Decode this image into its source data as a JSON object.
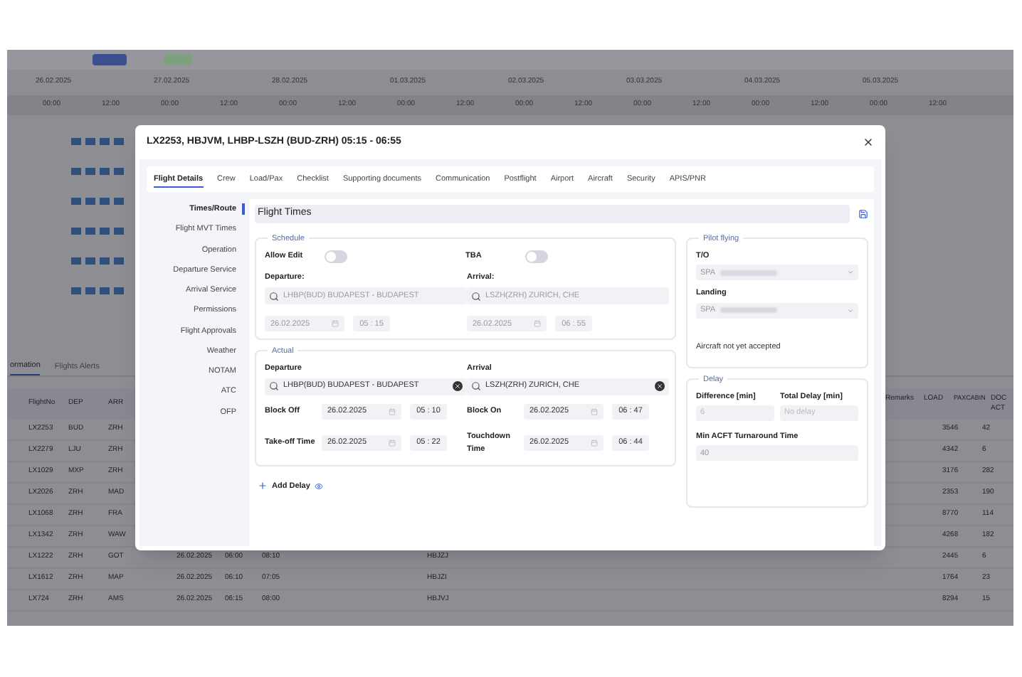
{
  "background": {
    "dates": [
      "26.02.2025",
      "27.02.2025",
      "28.02.2025",
      "01.03.2025",
      "02.03.2025",
      "03.03.2025",
      "04.03.2025",
      "05.03.2025"
    ],
    "times": [
      "00:00",
      "12:00",
      "00:00",
      "12:00",
      "00:00",
      "12:00",
      "00:00",
      "12:00",
      "00:00",
      "12:00",
      "00:00",
      "12:00",
      "00:00",
      "12:00",
      "00:00",
      "12:00"
    ],
    "bottom_tabs": [
      {
        "label": "ormation",
        "selected": true
      },
      {
        "label": "Flights Alerts",
        "selected": false
      }
    ],
    "left_columns": [
      "FlightNo",
      "DEP",
      "ARR"
    ],
    "right_columns": [
      "Remarks",
      "LOAD",
      "PAXCABIN",
      "DOC ACT"
    ],
    "rows": [
      {
        "flight_no": "LX2253",
        "dep": "BUD",
        "arr": "ZRH",
        "paxcabin": "3546",
        "doc_act": "42"
      },
      {
        "flight_no": "LX2279",
        "dep": "LJU",
        "arr": "ZRH",
        "paxcabin": "4342",
        "doc_act": "6"
      },
      {
        "flight_no": "LX1029",
        "dep": "MXP",
        "arr": "ZRH",
        "paxcabin": "3176",
        "doc_act": "282"
      },
      {
        "flight_no": "LX2026",
        "dep": "ZRH",
        "arr": "MAD",
        "paxcabin": "2353",
        "doc_act": "190"
      },
      {
        "flight_no": "LX1068",
        "dep": "ZRH",
        "arr": "FRA",
        "paxcabin": "8770",
        "doc_act": "114"
      },
      {
        "flight_no": "LX1342",
        "dep": "ZRH",
        "arr": "WAW",
        "paxcabin": "4268",
        "doc_act": "182"
      },
      {
        "flight_no": "LX1222",
        "dep": "ZRH",
        "arr": "GOT",
        "date": "26.02.2025",
        "std": "06:00",
        "sta": "08:10",
        "reg": "HBJZJ",
        "paxcabin": "2445",
        "doc_act": "6"
      },
      {
        "flight_no": "LX1612",
        "dep": "ZRH",
        "arr": "MAP",
        "date": "26.02.2025",
        "std": "06:10",
        "sta": "07:05",
        "reg": "HBJZI",
        "paxcabin": "1764",
        "doc_act": "23"
      },
      {
        "flight_no": "LX724",
        "dep": "ZRH",
        "arr": "AMS",
        "date": "26.02.2025",
        "std": "06:15",
        "sta": "08:00",
        "reg": "HBJVJ",
        "paxcabin": "8294",
        "doc_act": "15"
      }
    ]
  },
  "modal": {
    "title": "LX2253, HBJVM, LHBP-LSZH (BUD-ZRH) 05:15 - 06:55",
    "tabs": [
      {
        "label": "Flight Details",
        "selected": true
      },
      {
        "label": "Crew",
        "selected": false
      },
      {
        "label": "Load/Pax",
        "selected": false
      },
      {
        "label": "Checklist",
        "selected": false
      },
      {
        "label": "Supporting documents",
        "selected": false
      },
      {
        "label": "Communication",
        "selected": false
      },
      {
        "label": "Postflight",
        "selected": false
      },
      {
        "label": "Airport",
        "selected": false
      },
      {
        "label": "Aircraft",
        "selected": false
      },
      {
        "label": "Security",
        "selected": false
      },
      {
        "label": "APIS/PNR",
        "selected": false
      }
    ],
    "side_nav": [
      {
        "label": "Times/Route",
        "selected": true
      },
      {
        "label": "Flight MVT Times",
        "selected": false
      },
      {
        "label": "Operation",
        "selected": false
      },
      {
        "label": "Departure Service",
        "selected": false
      },
      {
        "label": "Arrival Service",
        "selected": false
      },
      {
        "label": "Permissions",
        "selected": false
      },
      {
        "label": "Flight Approvals",
        "selected": false
      },
      {
        "label": "Weather",
        "selected": false
      },
      {
        "label": "NOTAM",
        "selected": false
      },
      {
        "label": "ATC",
        "selected": false
      },
      {
        "label": "OFP",
        "selected": false
      }
    ],
    "section_title": "Flight Times",
    "schedule": {
      "legend": "Schedule",
      "toggles": [
        {
          "label": "Allow Edit",
          "on": false
        },
        {
          "label": "TBA",
          "on": false
        }
      ],
      "sides": [
        {
          "label": "Departure:",
          "airport": "LHBP(BUD) BUDAPEST - BUDAPEST",
          "date": "26.02.2025",
          "time": "05 : 15"
        },
        {
          "label": "Arrival:",
          "airport": "LSZH(ZRH) ZURICH, CHE",
          "date": "26.02.2025",
          "time": "06 : 55"
        }
      ]
    },
    "actual": {
      "legend": "Actual",
      "sides": [
        {
          "label": "Departure",
          "airport": "LHBP(BUD) BUDAPEST - BUDAPEST",
          "times": [
            {
              "label": "Block Off",
              "date": "26.02.2025",
              "time": "05 : 10"
            },
            {
              "label": "Take-off Time",
              "date": "26.02.2025",
              "time": "05 : 22"
            }
          ]
        },
        {
          "label": "Arrival",
          "airport": "LSZH(ZRH) ZURICH, CHE",
          "times": [
            {
              "label": "Block On",
              "date": "26.02.2025",
              "time": "06 : 47"
            },
            {
              "label": "Touchdown Time",
              "date": "26.02.2025",
              "time": "06 : 44"
            }
          ]
        }
      ]
    },
    "add_delay": "Add Delay",
    "pilot_flying": {
      "legend": "Pilot flying",
      "selects": [
        {
          "label": "T/O",
          "value": "SPA"
        },
        {
          "label": "Landing",
          "value": "SPA"
        }
      ],
      "note": "Aircraft not yet accepted"
    },
    "delay": {
      "legend": "Delay",
      "difference_label": "Difference [min]",
      "difference_placeholder": "6",
      "total_label": "Total Delay [min]",
      "total_placeholder": "No delay",
      "turnaround_label": "Min ACFT Turnaround Time",
      "turnaround_value": "40"
    }
  }
}
